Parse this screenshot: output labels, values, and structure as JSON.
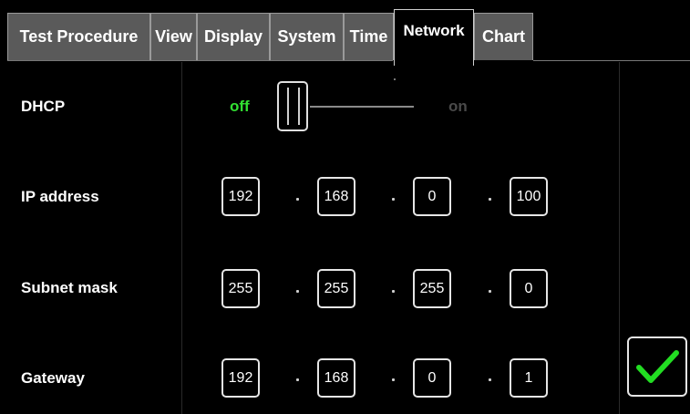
{
  "tabs": [
    {
      "label": "Test Procedure"
    },
    {
      "label": "View"
    },
    {
      "label": "Display"
    },
    {
      "label": "System"
    },
    {
      "label": "Time"
    },
    {
      "label": "Network",
      "active": true
    },
    {
      "label": "Chart"
    }
  ],
  "settings": {
    "dhcp": {
      "label": "DHCP",
      "off_label": "off",
      "on_label": "on",
      "state": "off"
    },
    "ip": {
      "label": "IP address",
      "octets": [
        "192",
        "168",
        "0",
        "100"
      ]
    },
    "subnet": {
      "label": "Subnet mask",
      "octets": [
        "255",
        "255",
        "255",
        "0"
      ]
    },
    "gateway": {
      "label": "Gateway",
      "octets": [
        "192",
        "168",
        "0",
        "1"
      ]
    }
  },
  "colors": {
    "active_green": "#32e032",
    "inactive_gray": "#4a4a4a",
    "confirm_green": "#22dd22"
  },
  "icons": {
    "confirm": "checkmark-icon"
  }
}
